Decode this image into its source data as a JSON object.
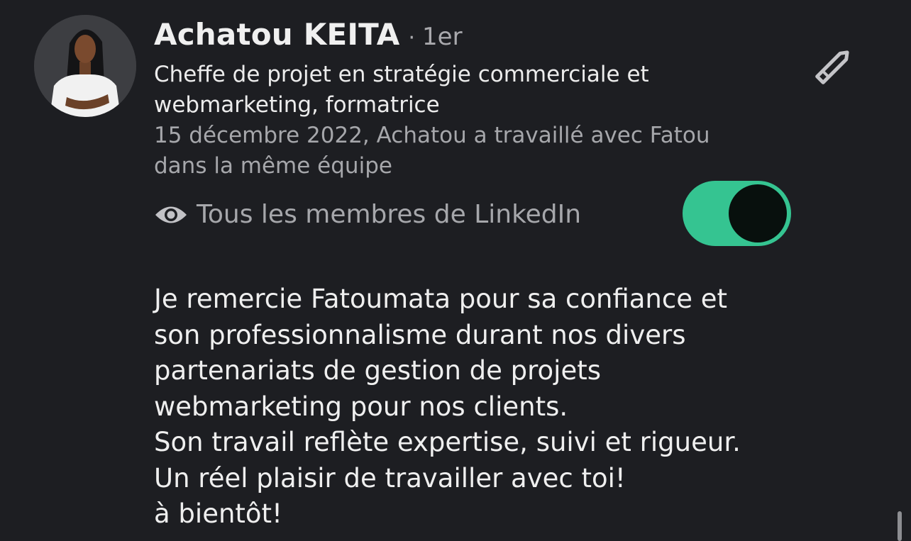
{
  "recommendation": {
    "author_name": "Achatou KEITA",
    "separator": "·",
    "connection_degree": "1er",
    "headline_lines": [
      "Cheffe de projet en stratégie commerciale et",
      "webmarketing, formatrice"
    ],
    "meta_lines": [
      "15 décembre 2022, Achatou a travaillé avec Fatou",
      "dans la même équipe"
    ],
    "visibility_label": "Tous les membres de LinkedIn",
    "visibility_toggle_on": true,
    "text_lines": [
      "Je remercie Fatoumata pour sa confiance et",
      "son professionnalisme durant nos divers",
      "partenariats de gestion de projets",
      "webmarketing pour nos clients.",
      "Son travail reflète expertise, suivi et rigueur.",
      "Un réel plaisir de travailler avec toi!",
      "à bientôt!"
    ]
  },
  "icons": {
    "edit": "pencil-icon",
    "visibility": "eye-icon"
  },
  "colors": {
    "background": "#1d1e22",
    "toggle_on": "#35c491",
    "secondary_text": "#a6a7ab"
  }
}
